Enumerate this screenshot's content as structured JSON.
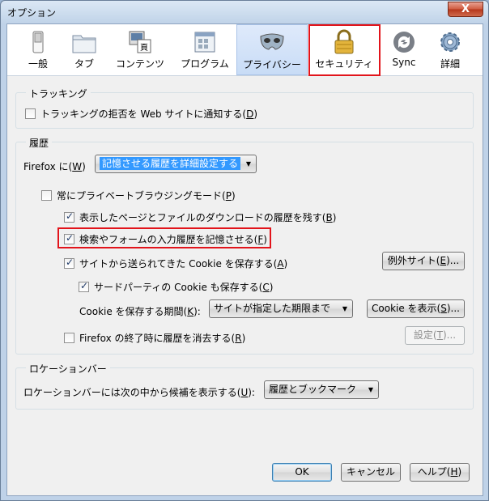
{
  "window": {
    "title": "オプション",
    "close_glyph": "X"
  },
  "tabs": [
    {
      "label": "一般",
      "icon": "switch-icon"
    },
    {
      "label": "タブ",
      "icon": "folder-tabs-icon"
    },
    {
      "label": "コンテンツ",
      "icon": "content-icon"
    },
    {
      "label": "プログラム",
      "icon": "applications-icon"
    },
    {
      "label": "プライバシー",
      "icon": "mask-icon",
      "selected": true
    },
    {
      "label": "セキュリティ",
      "icon": "padlock-icon",
      "highlighted": true
    },
    {
      "label": "Sync",
      "icon": "sync-icon"
    },
    {
      "label": "詳細",
      "icon": "gear-icon"
    }
  ],
  "tracking": {
    "title": "トラッキング",
    "dnt_label": "トラッキングの拒否を Web サイトに通知する(",
    "dnt_key": "D",
    "dnt_checked": false
  },
  "history": {
    "title": "履歴",
    "firefox_label": "Firefox に(",
    "firefox_key": "W",
    "mode_value": "記憶させる履歴を詳細設定する",
    "private_label": "常にプライベートブラウジングモード(",
    "private_key": "P",
    "browse_label": "表示したページとファイルのダウンロードの履歴を残す(",
    "browse_key": "B",
    "form_label": "検索やフォームの入力履歴を記憶させる(",
    "form_key": "F",
    "cookies_label": "サイトから送られてきた Cookie を保存する(",
    "cookies_key": "A",
    "exceptions_label": "例外サイト(",
    "exceptions_key": "E",
    "third_party_label": "サードパーティの Cookie も保存する(",
    "third_party_key": "C",
    "keep_label": "Cookie を保存する期間(",
    "keep_key": "K",
    "keep_value": "サイトが指定した期限まで",
    "show_cookies_label": "Cookie を表示(",
    "show_cookies_key": "S",
    "clear_label": "Firefox の終了時に履歴を消去する(",
    "clear_key": "R",
    "settings_label": "設定(",
    "settings_key": "T"
  },
  "location_bar": {
    "title": "ロケーションバー",
    "suggest_label": "ロケーションバーには次の中から候補を表示する(",
    "suggest_key": "U",
    "suggest_value": "履歴とブックマーク"
  },
  "footer": {
    "ok": "OK",
    "cancel": "キャンセル",
    "help_label": "ヘルプ(",
    "help_key": "H"
  },
  "colors": {
    "highlight": "#e2141b",
    "accent": "#3399ff"
  }
}
